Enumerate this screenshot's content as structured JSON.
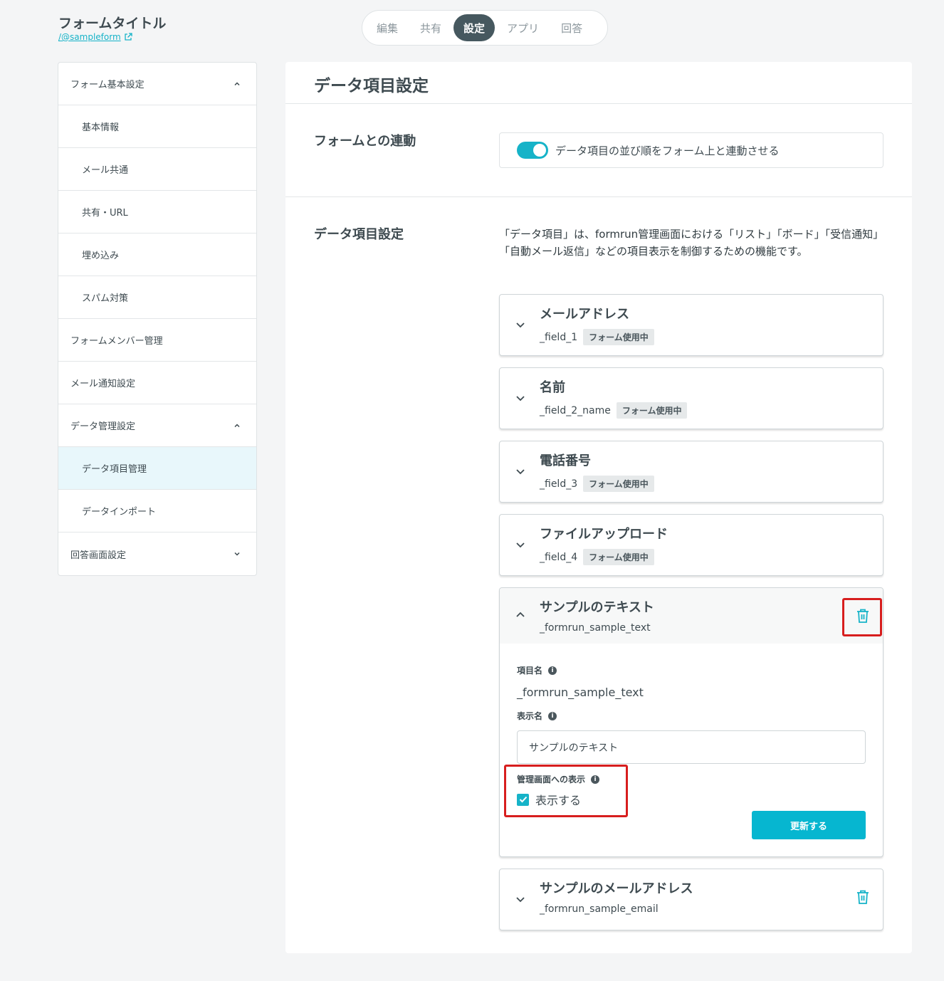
{
  "header": {
    "title": "フォームタイトル",
    "link": "/@sampleform"
  },
  "tabs": [
    {
      "label": "編集",
      "active": false
    },
    {
      "label": "共有",
      "active": false
    },
    {
      "label": "設定",
      "active": true
    },
    {
      "label": "アプリ",
      "active": false
    },
    {
      "label": "回答",
      "active": false
    }
  ],
  "sidebar": {
    "items": [
      {
        "label": "フォーム基本設定",
        "sub": false,
        "chevron": "up"
      },
      {
        "label": "基本情報",
        "sub": true
      },
      {
        "label": "メール共通",
        "sub": true
      },
      {
        "label": "共有・URL",
        "sub": true
      },
      {
        "label": "埋め込み",
        "sub": true
      },
      {
        "label": "スパム対策",
        "sub": true
      },
      {
        "label": "フォームメンバー管理",
        "sub": false
      },
      {
        "label": "メール通知設定",
        "sub": false
      },
      {
        "label": "データ管理設定",
        "sub": false,
        "chevron": "up"
      },
      {
        "label": "データ項目管理",
        "sub": true,
        "active": true
      },
      {
        "label": "データインポート",
        "sub": true
      },
      {
        "label": "回答画面設定",
        "sub": false,
        "chevron": "down"
      }
    ]
  },
  "main": {
    "title": "データ項目設定",
    "link_section": {
      "label": "フォームとの連動",
      "toggle_label": "データ項目の並び順をフォーム上と連動させる",
      "toggle_on": true
    },
    "fields_section": {
      "label": "データ項目設定",
      "description": "「データ項目」は、formrun管理画面における「リスト」「ボード」「受信通知」「自動メール返信」などの項目表示を制御するための機能です。"
    },
    "cards": [
      {
        "title": "メールアドレス",
        "field": "_field_1",
        "badge": "フォーム使用中"
      },
      {
        "title": "名前",
        "field": "_field_2_name",
        "badge": "フォーム使用中"
      },
      {
        "title": "電話番号",
        "field": "_field_3",
        "badge": "フォーム使用中"
      },
      {
        "title": "ファイルアップロード",
        "field": "_field_4",
        "badge": "フォーム使用中"
      }
    ],
    "expanded_card": {
      "title": "サンプルのテキスト",
      "field": "_formrun_sample_text",
      "item_name_label": "項目名",
      "item_name_value": "_formrun_sample_text",
      "display_name_label": "表示名",
      "display_name_value": "サンプルのテキスト",
      "admin_display_label": "管理画面への表示",
      "show_checkbox_label": "表示する",
      "show_checked": true,
      "update_button": "更新する"
    },
    "last_card": {
      "title": "サンプルのメールアドレス",
      "field": "_formrun_sample_email"
    }
  },
  "colors": {
    "accent": "#16b3c8",
    "highlight": "#d71e1e",
    "active_tab": "#46585f"
  }
}
